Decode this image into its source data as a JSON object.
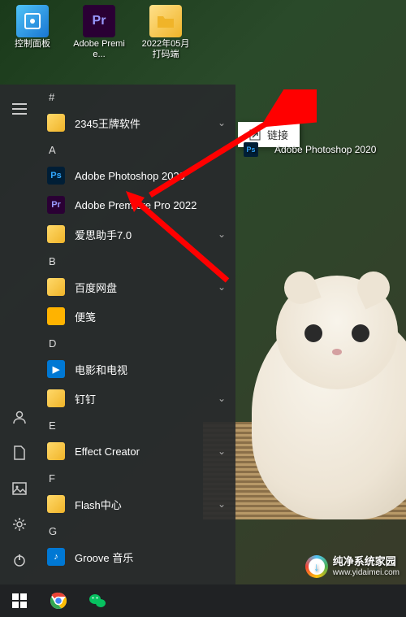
{
  "desktop_icons": [
    {
      "label": "控制面板",
      "kind": "control-panel"
    },
    {
      "label": "Adobe Premie...",
      "kind": "premiere"
    },
    {
      "label": "2022年05月打码端",
      "kind": "folder"
    }
  ],
  "drag": {
    "popup_label": "链接",
    "ghost_label": "Adobe Photoshop 2020"
  },
  "start_menu": {
    "groups": [
      {
        "header": "#",
        "items": [
          {
            "name": "2345王牌软件",
            "icon": "folder",
            "expandable": true
          }
        ]
      },
      {
        "header": "A",
        "items": [
          {
            "name": "Adobe Photoshop 2020",
            "icon": "photoshop",
            "expandable": false
          },
          {
            "name": "Adobe Premiere Pro 2022",
            "icon": "premiere",
            "expandable": false
          },
          {
            "name": "爱思助手7.0",
            "icon": "folder",
            "expandable": true
          }
        ]
      },
      {
        "header": "B",
        "items": [
          {
            "name": "百度网盘",
            "icon": "folder",
            "expandable": true
          },
          {
            "name": "便笺",
            "icon": "sticky",
            "expandable": false
          }
        ]
      },
      {
        "header": "D",
        "items": [
          {
            "name": "电影和电视",
            "icon": "movies",
            "expandable": false
          },
          {
            "name": "钉钉",
            "icon": "folder",
            "expandable": true
          }
        ]
      },
      {
        "header": "E",
        "items": [
          {
            "name": "Effect Creator",
            "icon": "folder",
            "expandable": true
          }
        ]
      },
      {
        "header": "F",
        "items": [
          {
            "name": "Flash中心",
            "icon": "folder",
            "expandable": true
          }
        ]
      },
      {
        "header": "G",
        "items": [
          {
            "name": "Groove 音乐",
            "icon": "groove",
            "expandable": false
          }
        ]
      }
    ]
  },
  "watermark": {
    "name": "纯净系统家园",
    "url": "www.yidaimei.com"
  },
  "colors": {
    "photoshop_bg": "#001e36",
    "photoshop_fg": "#31a8ff",
    "premiere_bg": "#2a0034",
    "premiere_fg": "#9999ff",
    "folder": "#f0b429",
    "arrow": "#ff0000"
  }
}
